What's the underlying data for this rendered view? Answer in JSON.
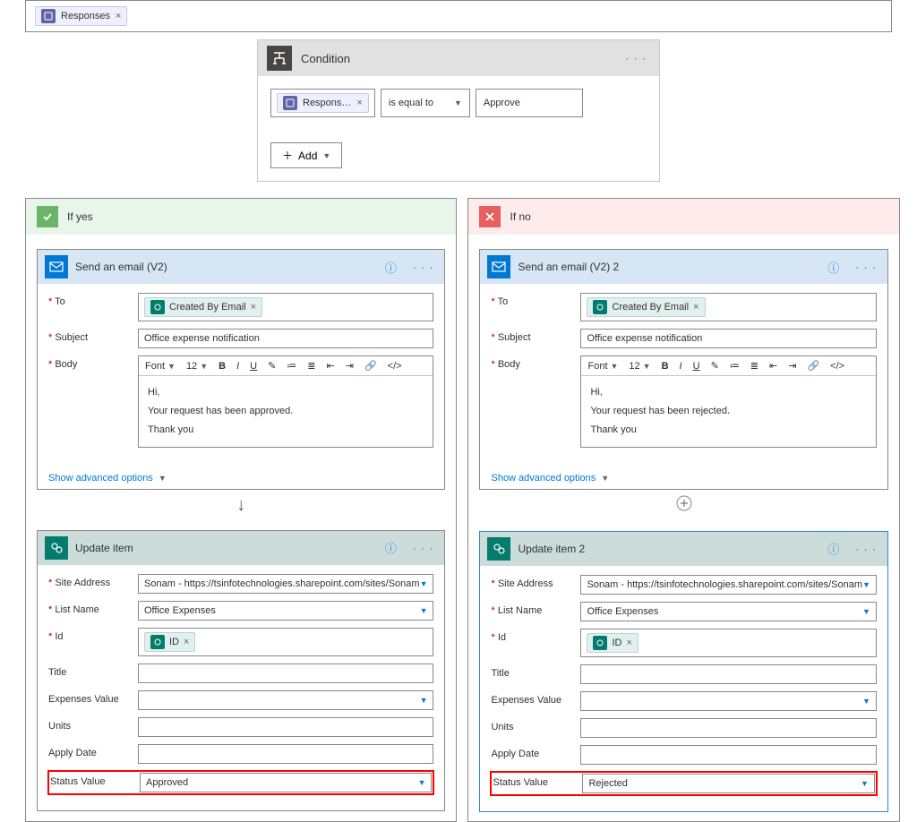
{
  "loop_token": "Responses",
  "condition": {
    "title": "Condition",
    "left_token": "Respons…",
    "operator": "is equal to",
    "right_value": "Approve",
    "add_label": "Add"
  },
  "yes": {
    "title": "If yes",
    "email": {
      "title": "Send an email (V2)",
      "to_label": "To",
      "to_token": "Created By Email",
      "subject_label": "Subject",
      "subject_value": "Office expense notification",
      "body_label": "Body",
      "font_label": "Font",
      "font_size": "12",
      "body_line1": "Hi,",
      "body_line2": "Your request has been approved.",
      "body_line3": "Thank you",
      "advanced": "Show advanced options"
    },
    "update": {
      "title": "Update item",
      "site_label": "Site Address",
      "site_value": "Sonam - https://tsinfotechnologies.sharepoint.com/sites/Sonam",
      "list_label": "List Name",
      "list_value": "Office Expenses",
      "id_label": "Id",
      "id_token": "ID",
      "title_label": "Title",
      "expenses_label": "Expenses Value",
      "units_label": "Units",
      "apply_label": "Apply Date",
      "status_label": "Status Value",
      "status_value": "Approved"
    }
  },
  "no": {
    "title": "If no",
    "email": {
      "title": "Send an email (V2) 2",
      "to_label": "To",
      "to_token": "Created By Email",
      "subject_label": "Subject",
      "subject_value": "Office expense notification",
      "body_label": "Body",
      "font_label": "Font",
      "font_size": "12",
      "body_line1": "Hi,",
      "body_line2": "Your request has been rejected.",
      "body_line3": "Thank you",
      "advanced": "Show advanced options"
    },
    "update": {
      "title": "Update item 2",
      "site_label": "Site Address",
      "site_value": "Sonam - https://tsinfotechnologies.sharepoint.com/sites/Sonam",
      "list_label": "List Name",
      "list_value": "Office Expenses",
      "id_label": "Id",
      "id_token": "ID",
      "title_label": "Title",
      "expenses_label": "Expenses Value",
      "units_label": "Units",
      "apply_label": "Apply Date",
      "status_label": "Status Value",
      "status_value": "Rejected"
    }
  }
}
